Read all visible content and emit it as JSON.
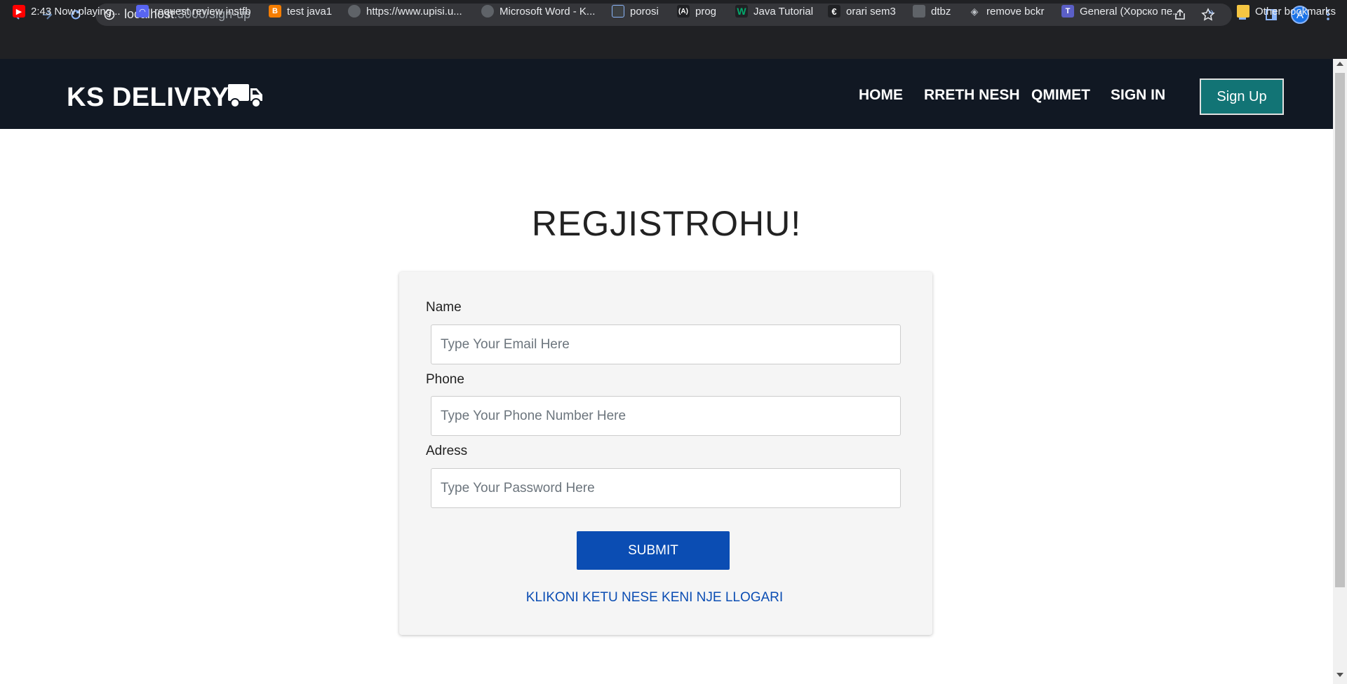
{
  "browser": {
    "url_host": "localhost",
    "url_path": ":3000/sign-up",
    "profile_initial": "A",
    "bookmarks": [
      {
        "label": "2:43 Now playing...",
        "icon": "youtube-icon",
        "color": "#ff0000"
      },
      {
        "label": "request review instfb",
        "icon": "bookmark-site-icon",
        "color": "#5865f2"
      },
      {
        "label": "test java1",
        "icon": "blogger-icon",
        "color": "#f57d00"
      },
      {
        "label": "https://www.upisi.u...",
        "icon": "globe-icon",
        "color": "#5f6368"
      },
      {
        "label": "Microsoft Word - K...",
        "icon": "globe-icon",
        "color": "#5f6368"
      },
      {
        "label": "porosi",
        "icon": "site-icon",
        "color": "#3c4043"
      },
      {
        "label": "prog",
        "icon": "angular-icon",
        "color": "#202124"
      },
      {
        "label": "Java Tutorial",
        "icon": "w3-icon",
        "color": "#04aa6d"
      },
      {
        "label": "orari sem3",
        "icon": "site-icon",
        "color": "#202124"
      },
      {
        "label": "dtbz",
        "icon": "site-icon",
        "color": "#5f6368"
      },
      {
        "label": "remove bckr",
        "icon": "layers-icon",
        "color": "#5f6368"
      },
      {
        "label": "General (Хорско пе...",
        "icon": "teams-icon",
        "color": "#5b5fc7"
      }
    ],
    "other_bookmarks": "Other bookmarks",
    "overflow": "»"
  },
  "navbar": {
    "brand": "KS DELIVRY",
    "links": [
      "HOME",
      "RRETH NESH",
      "QMIMET",
      "SIGN IN"
    ],
    "signup": "Sign Up"
  },
  "form": {
    "title": "REGJISTROHU!",
    "fields": [
      {
        "label": "Name",
        "placeholder": "Type Your Email Here"
      },
      {
        "label": "Phone",
        "placeholder": "Type Your Phone Number Here"
      },
      {
        "label": "Adress",
        "placeholder": "Type Your Password Here"
      }
    ],
    "submit": "SUBMIT",
    "link": "KLIKONI KETU NESE KENI NJE LLOGARI"
  },
  "colors": {
    "navbar": "#111823",
    "signup_button": "#127475",
    "submit_button": "#0b4db3",
    "link": "#0b4db3",
    "card": "#f5f5f5"
  }
}
